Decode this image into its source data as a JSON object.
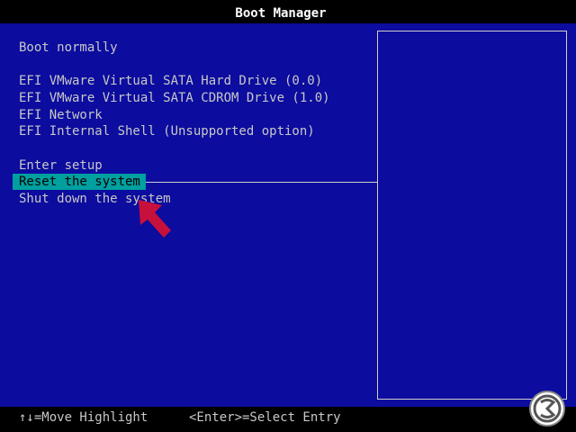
{
  "window": {
    "title": "Boot Manager"
  },
  "menu": {
    "items": [
      {
        "label": "Boot normally",
        "selected": false
      },
      {
        "label": "EFI VMware Virtual SATA Hard Drive (0.0)",
        "selected": false
      },
      {
        "label": "EFI VMware Virtual SATA CDROM Drive (1.0)",
        "selected": false
      },
      {
        "label": "EFI Network",
        "selected": false
      },
      {
        "label": "EFI Internal Shell (Unsupported option)",
        "selected": false
      },
      {
        "label": "Enter setup",
        "selected": false
      },
      {
        "label": "Reset the system",
        "selected": true
      },
      {
        "label": "Shut down the system",
        "selected": false
      }
    ]
  },
  "footer": {
    "move_hint": "↑↓=Move Highlight",
    "select_hint": "<Enter>=Select Entry"
  },
  "colors": {
    "background": "#0c0c9e",
    "highlight": "#00a0a0",
    "text": "#c8c8c8",
    "annotation_arrow": "#c8103c"
  },
  "icons": {
    "annotation": "red-arrow-pointer",
    "watermark": "logo-icon"
  }
}
